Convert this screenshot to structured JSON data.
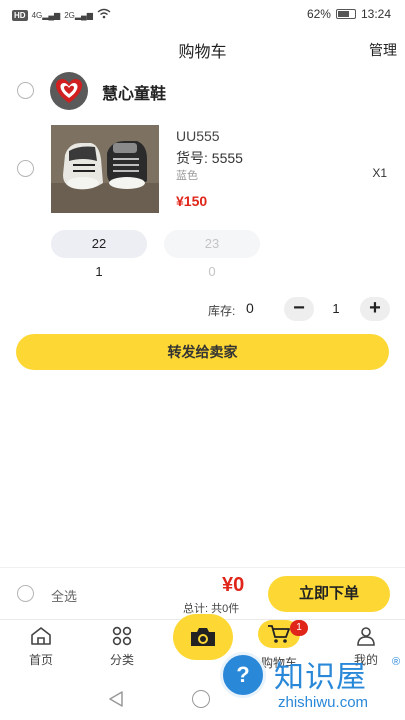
{
  "status_bar": {
    "left": "HD",
    "signal_1": "4G",
    "signal_2": "2G",
    "battery": "62%",
    "time": "13:24"
  },
  "header": {
    "title": "购物车",
    "manage": "管理"
  },
  "shop": {
    "name": "慧心童鞋"
  },
  "product": {
    "code": "UU555",
    "item_number": "货号:  5555",
    "color": "蓝色",
    "price": "¥150",
    "quantity_mark": "X1",
    "sizes": [
      {
        "size": "22",
        "count": "1"
      },
      {
        "size": "23",
        "count": "0"
      }
    ],
    "stock_label": "库存:",
    "stock_value": "0",
    "stepper_value": "1"
  },
  "forward_button": "转发给卖家",
  "checkout": {
    "select_all": "全选",
    "amount": "¥0",
    "total": "总计:  共0件",
    "submit": "立即下单"
  },
  "tabs": [
    {
      "label": "首页",
      "icon": "home-icon"
    },
    {
      "label": "分类",
      "icon": "category-grid-icon"
    },
    {
      "label": "",
      "icon": "camera-icon"
    },
    {
      "label": "购物车",
      "icon": "cart-icon",
      "badge": "1"
    },
    {
      "label": "我的",
      "icon": "person-icon"
    }
  ],
  "watermark": {
    "title": "知识屋",
    "reg": "®",
    "url": "zhishiwu.com"
  },
  "colors": {
    "accent": "#fdd835",
    "price": "#e0251a",
    "watermark": "#2a88d8"
  }
}
